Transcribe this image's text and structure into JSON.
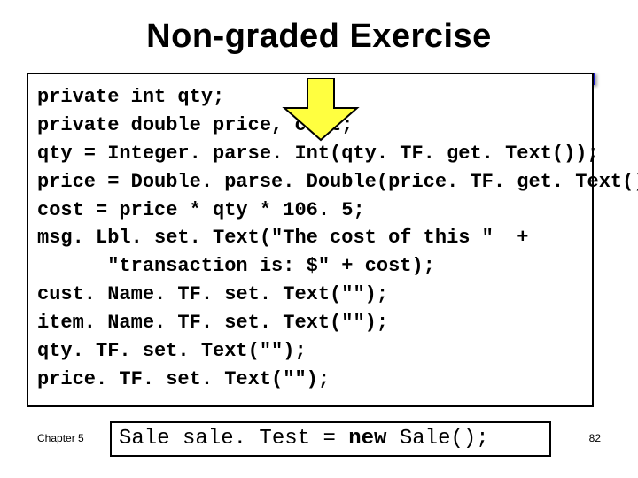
{
  "title": "Non-graded Exercise",
  "code": {
    "lines": [
      "private int qty;",
      "private double price, cost;",
      "qty = Integer. parse. Int(qty. TF. get. Text());",
      "price = Double. parse. Double(price. TF. get. Text());",
      "cost = price * qty * 106. 5;",
      "msg. Lbl. set. Text(\"The cost of this \"  +",
      "      \"transaction is: $\" + cost);",
      "cust. Name. TF. set. Text(\"\");",
      "item. Name. TF. set. Text(\"\");",
      "qty. TF. set. Text(\"\");",
      "price. TF. set. Text(\"\");"
    ]
  },
  "footer": {
    "chapter": "Chapter 5",
    "sale_prefix": "Sale sale. Test = ",
    "sale_keyword": "new",
    "sale_suffix": " Sale();",
    "pagenum": "82"
  },
  "arrow": {
    "color": "#ffff40",
    "stroke": "#000000"
  }
}
